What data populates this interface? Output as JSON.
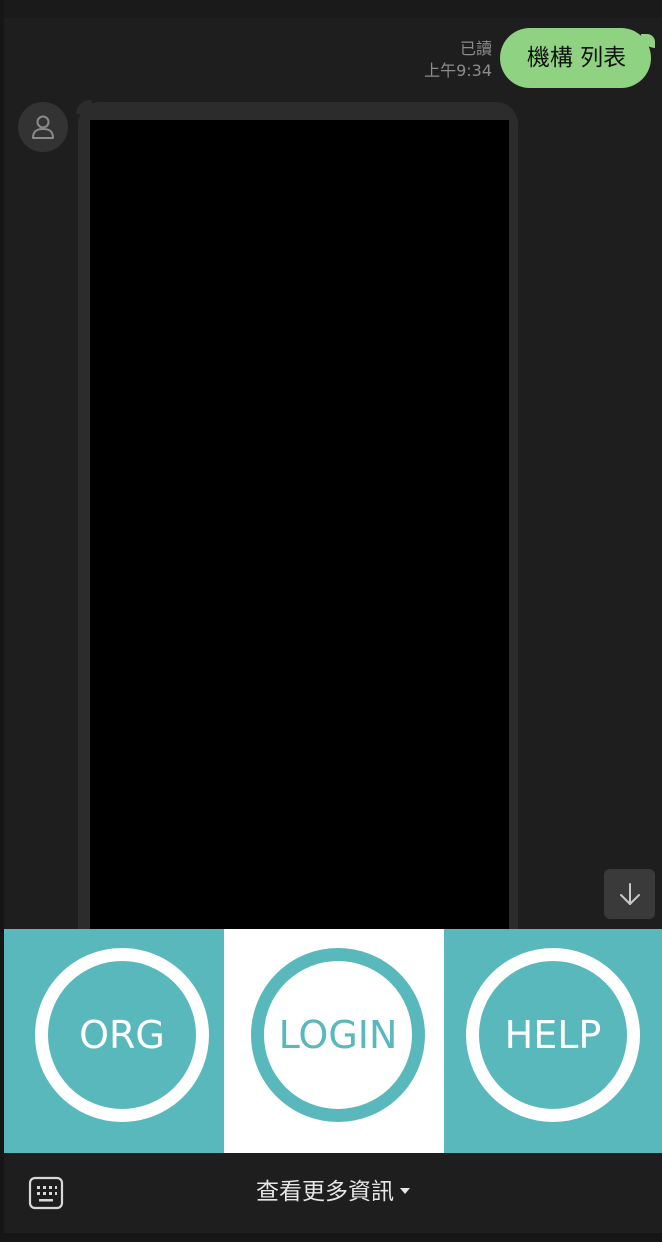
{
  "chat": {
    "outgoing": {
      "read_status": "已讀",
      "time": "上午9:34",
      "text": "機構 列表"
    },
    "incoming": {
      "avatar_icon": "user-icon",
      "media_color": "#000000"
    },
    "scroll_down_icon": "arrow-down-icon"
  },
  "rich_menu": {
    "items": [
      {
        "label": "ORG"
      },
      {
        "label": "LOGIN"
      },
      {
        "label": "HELP"
      }
    ],
    "colors": {
      "teal": "#59b8bc",
      "white": "#ffffff"
    }
  },
  "bottom_bar": {
    "keyboard_icon": "keyboard-icon",
    "more_info_label": "查看更多資訊",
    "more_info_icon": "caret-down-icon"
  },
  "colors": {
    "background": "#1e1e1e",
    "outgoing_bubble": "#8fd281",
    "incoming_bubble": "#2c2c2c"
  }
}
